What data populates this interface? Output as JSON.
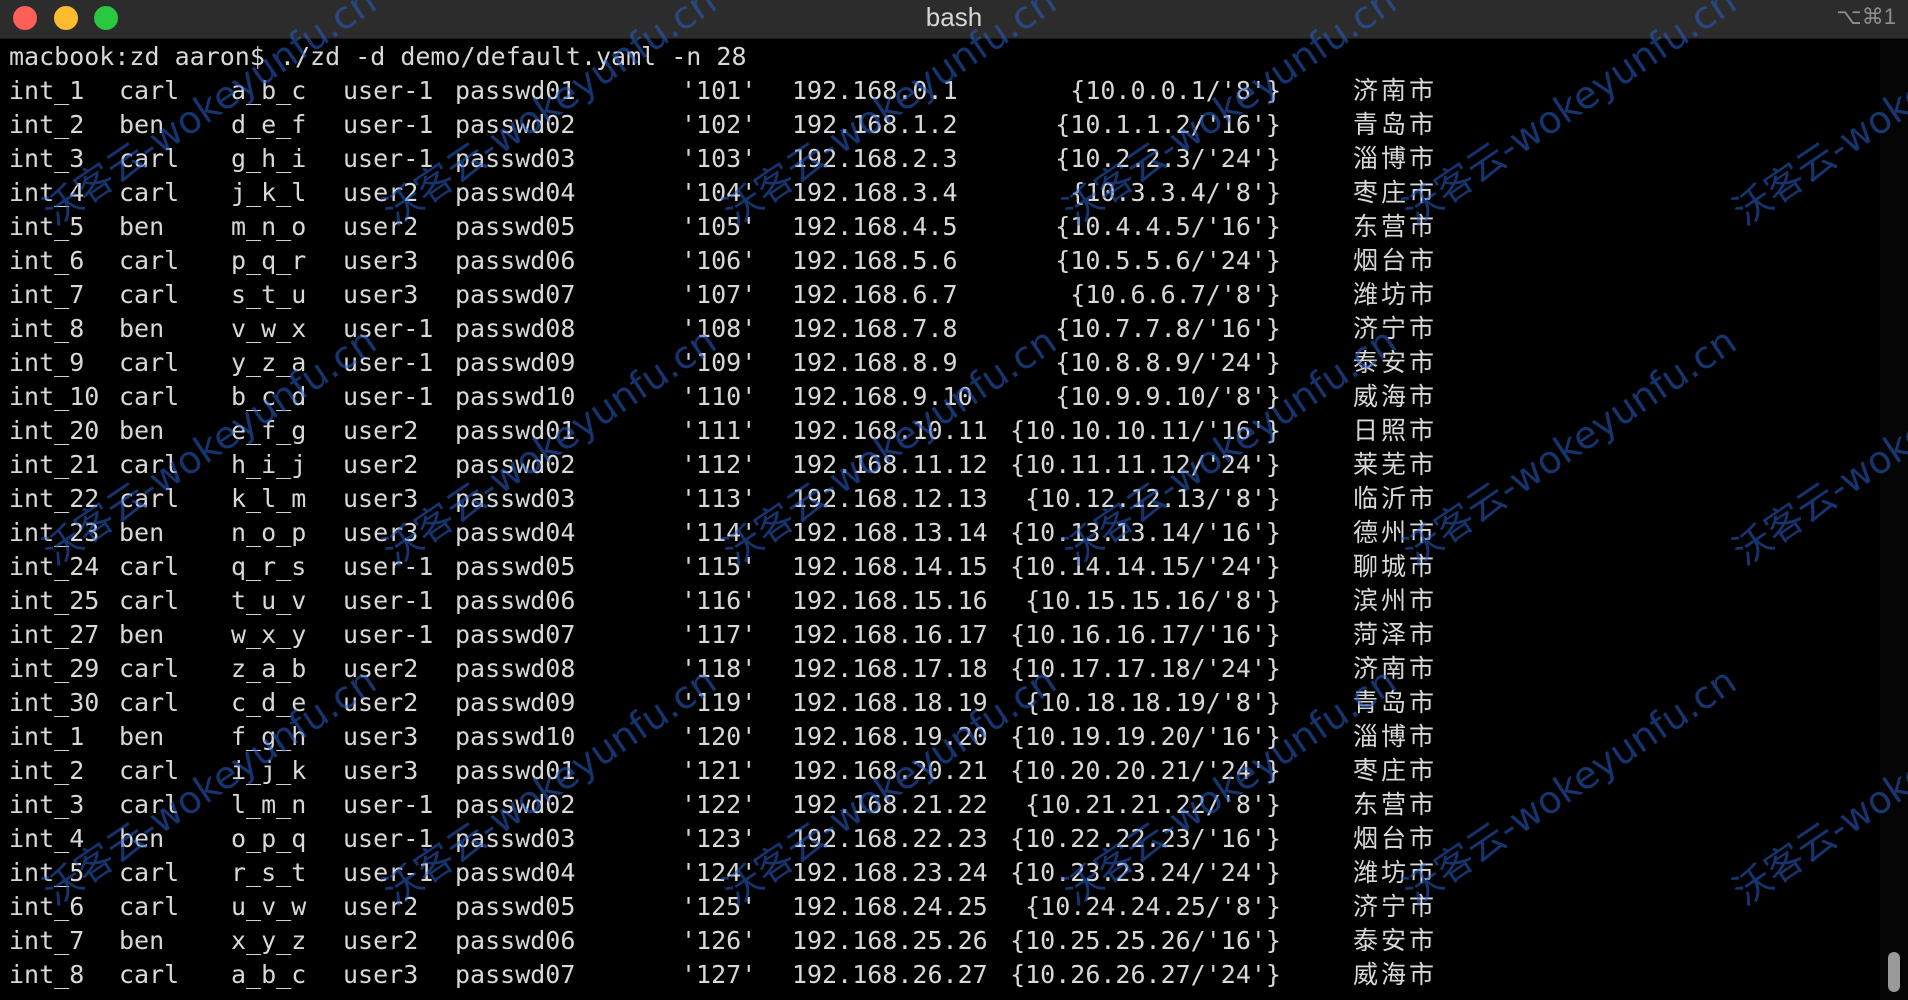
{
  "window": {
    "title": "bash",
    "shortcut": "⌥⌘1"
  },
  "terminal": {
    "command": "macbook:zd aaron$ ./zd -d demo/default.yaml -n 28",
    "rows": [
      [
        "int_1",
        "carl",
        "a_b_c",
        "user-1",
        "passwd01",
        "'101'",
        "192.168.0.1",
        "{10.0.0.1/'8'}",
        "济南市"
      ],
      [
        "int_2",
        "ben",
        "d_e_f",
        "user-1",
        "passwd02",
        "'102'",
        "192.168.1.2",
        "{10.1.1.2/'16'}",
        "青岛市"
      ],
      [
        "int_3",
        "carl",
        "g_h_i",
        "user-1",
        "passwd03",
        "'103'",
        "192.168.2.3",
        "{10.2.2.3/'24'}",
        "淄博市"
      ],
      [
        "int_4",
        "carl",
        "j_k_l",
        "user2",
        "passwd04",
        "'104'",
        "192.168.3.4",
        "{10.3.3.4/'8'}",
        "枣庄市"
      ],
      [
        "int_5",
        "ben",
        "m_n_o",
        "user2",
        "passwd05",
        "'105'",
        "192.168.4.5",
        "{10.4.4.5/'16'}",
        "东营市"
      ],
      [
        "int_6",
        "carl",
        "p_q_r",
        "user3",
        "passwd06",
        "'106'",
        "192.168.5.6",
        "{10.5.5.6/'24'}",
        "烟台市"
      ],
      [
        "int_7",
        "carl",
        "s_t_u",
        "user3",
        "passwd07",
        "'107'",
        "192.168.6.7",
        "{10.6.6.7/'8'}",
        "潍坊市"
      ],
      [
        "int_8",
        "ben",
        "v_w_x",
        "user-1",
        "passwd08",
        "'108'",
        "192.168.7.8",
        "{10.7.7.8/'16'}",
        "济宁市"
      ],
      [
        "int_9",
        "carl",
        "y_z_a",
        "user-1",
        "passwd09",
        "'109'",
        "192.168.8.9",
        "{10.8.8.9/'24'}",
        "泰安市"
      ],
      [
        "int_10",
        "carl",
        "b_c_d",
        "user-1",
        "passwd10",
        "'110'",
        "192.168.9.10",
        "{10.9.9.10/'8'}",
        "威海市"
      ],
      [
        "int_20",
        "ben",
        "e_f_g",
        "user2",
        "passwd01",
        "'111'",
        "192.168.10.11",
        "{10.10.10.11/'16'}",
        "日照市"
      ],
      [
        "int_21",
        "carl",
        "h_i_j",
        "user2",
        "passwd02",
        "'112'",
        "192.168.11.12",
        "{10.11.11.12/'24'}",
        "莱芜市"
      ],
      [
        "int_22",
        "carl",
        "k_l_m",
        "user3",
        "passwd03",
        "'113'",
        "192.168.12.13",
        "{10.12.12.13/'8'}",
        "临沂市"
      ],
      [
        "int_23",
        "ben",
        "n_o_p",
        "user3",
        "passwd04",
        "'114'",
        "192.168.13.14",
        "{10.13.13.14/'16'}",
        "德州市"
      ],
      [
        "int_24",
        "carl",
        "q_r_s",
        "user-1",
        "passwd05",
        "'115'",
        "192.168.14.15",
        "{10.14.14.15/'24'}",
        "聊城市"
      ],
      [
        "int_25",
        "carl",
        "t_u_v",
        "user-1",
        "passwd06",
        "'116'",
        "192.168.15.16",
        "{10.15.15.16/'8'}",
        "滨州市"
      ],
      [
        "int_27",
        "ben",
        "w_x_y",
        "user-1",
        "passwd07",
        "'117'",
        "192.168.16.17",
        "{10.16.16.17/'16'}",
        "菏泽市"
      ],
      [
        "int_29",
        "carl",
        "z_a_b",
        "user2",
        "passwd08",
        "'118'",
        "192.168.17.18",
        "{10.17.17.18/'24'}",
        "济南市"
      ],
      [
        "int_30",
        "carl",
        "c_d_e",
        "user2",
        "passwd09",
        "'119'",
        "192.168.18.19",
        "{10.18.18.19/'8'}",
        "青岛市"
      ],
      [
        "int_1",
        "ben",
        "f_g_h",
        "user3",
        "passwd10",
        "'120'",
        "192.168.19.20",
        "{10.19.19.20/'16'}",
        "淄博市"
      ],
      [
        "int_2",
        "carl",
        "i_j_k",
        "user3",
        "passwd01",
        "'121'",
        "192.168.20.21",
        "{10.20.20.21/'24'}",
        "枣庄市"
      ],
      [
        "int_3",
        "carl",
        "l_m_n",
        "user-1",
        "passwd02",
        "'122'",
        "192.168.21.22",
        "{10.21.21.22/'8'}",
        "东营市"
      ],
      [
        "int_4",
        "ben",
        "o_p_q",
        "user-1",
        "passwd03",
        "'123'",
        "192.168.22.23",
        "{10.22.22.23/'16'}",
        "烟台市"
      ],
      [
        "int_5",
        "carl",
        "r_s_t",
        "user-1",
        "passwd04",
        "'124'",
        "192.168.23.24",
        "{10.23.23.24/'24'}",
        "潍坊市"
      ],
      [
        "int_6",
        "carl",
        "u_v_w",
        "user2",
        "passwd05",
        "'125'",
        "192.168.24.25",
        "{10.24.24.25/'8'}",
        "济宁市"
      ],
      [
        "int_7",
        "ben",
        "x_y_z",
        "user2",
        "passwd06",
        "'126'",
        "192.168.25.26",
        "{10.25.25.26/'16'}",
        "泰安市"
      ],
      [
        "int_8",
        "carl",
        "a_b_c",
        "user3",
        "passwd07",
        "'127'",
        "192.168.26.27",
        "{10.26.26.27/'24'}",
        "威海市"
      ]
    ]
  },
  "watermark": {
    "text": "沃客云-wokeyunfu.cn",
    "color": "#285fc8"
  },
  "colors": {
    "close": "#fe5f57",
    "minimize": "#febc2e",
    "maximize": "#28c840"
  }
}
